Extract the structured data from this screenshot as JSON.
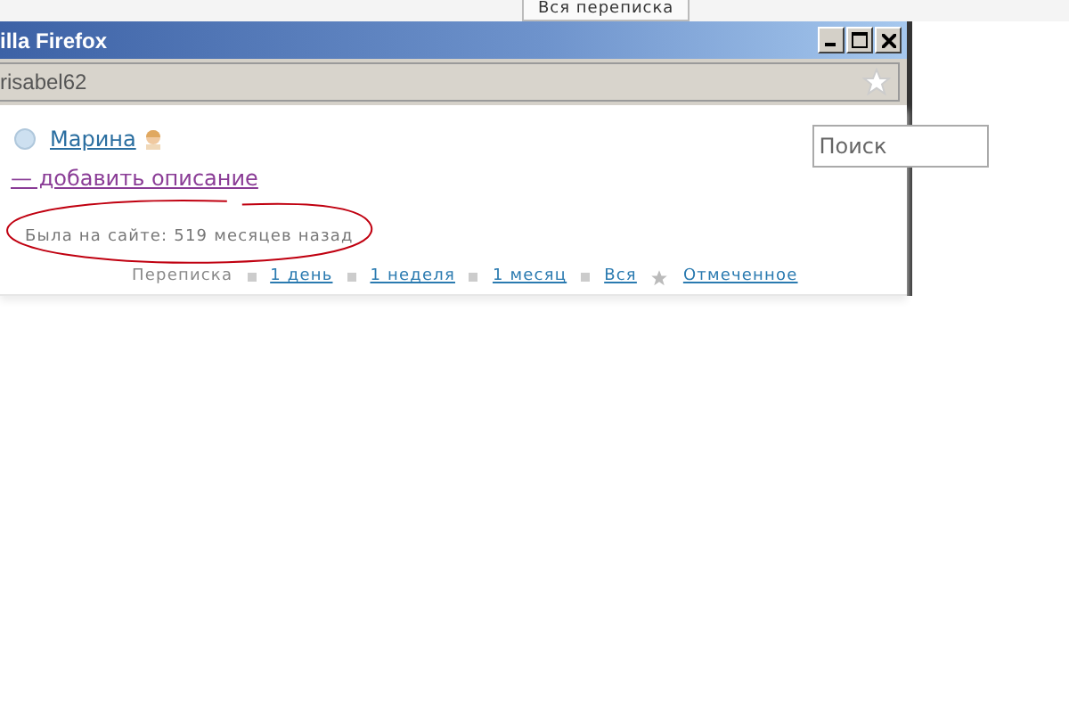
{
  "background_tab": {
    "label": "Вся переписка"
  },
  "window": {
    "title": "illa Firefox"
  },
  "address_bar": {
    "value": "risabel62"
  },
  "profile": {
    "name": "Марина",
    "description_link": "— добавить описание",
    "last_seen": "Была на сайте: 519 месяцев назад"
  },
  "search": {
    "placeholder": "Поиск"
  },
  "filters": {
    "label": "Переписка",
    "links": [
      {
        "label": "1 день",
        "kind": "link"
      },
      {
        "label": "1 неделя",
        "kind": "link"
      },
      {
        "label": "1 месяц",
        "kind": "link"
      },
      {
        "label": "Вся",
        "kind": "link"
      },
      {
        "label": "Отмеченное",
        "kind": "starred"
      }
    ]
  }
}
